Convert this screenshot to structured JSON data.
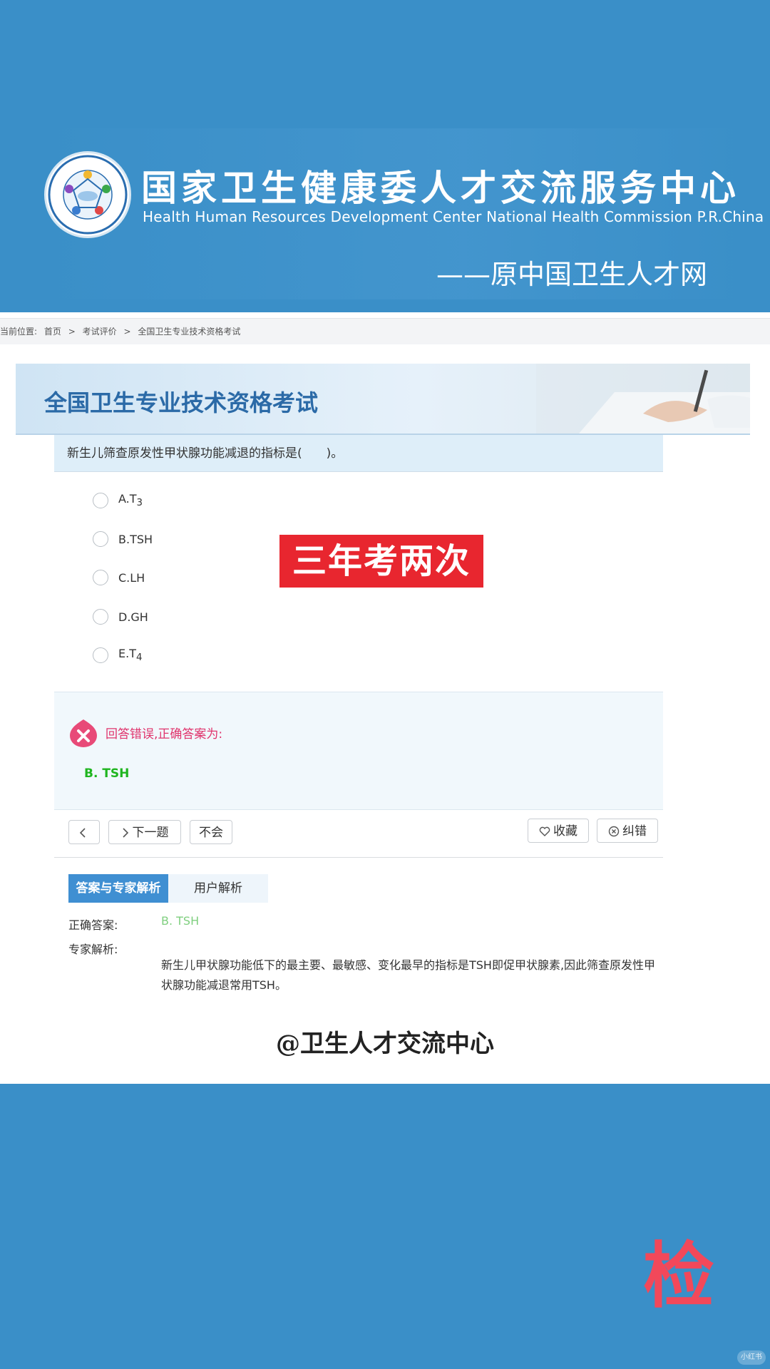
{
  "header": {
    "org_cn": "国家卫生健康委人才交流服务中心",
    "org_en": "Health Human Resources Development Center National Health Commission P.R.China",
    "former_name": "——原中国卫生人才网",
    "logo_text": "国家卫生健康委人才交流服务中心"
  },
  "breadcrumb": {
    "prefix": "当前位置:",
    "items": [
      "首页",
      "考试评价",
      "全国卫生专业技术资格考试"
    ],
    "separator": ">"
  },
  "exam_banner": {
    "title": "全国卫生专业技术资格考试"
  },
  "question": {
    "text": "新生儿筛查原发性甲状腺功能减退的指标是(　　)。",
    "options": [
      {
        "label": "A.T",
        "sub": "3"
      },
      {
        "label": "B.TSH",
        "sub": ""
      },
      {
        "label": "C.LH",
        "sub": ""
      },
      {
        "label": "D.GH",
        "sub": ""
      },
      {
        "label": "E.T",
        "sub": "4"
      }
    ]
  },
  "stamp": "三年考两次",
  "result": {
    "message": "回答错误,正确答案为:",
    "answer": "B. TSH"
  },
  "toolbar": {
    "prev_label": "",
    "next_label": "下一题",
    "dont_know_label": "不会",
    "favorite_label": "收藏",
    "report_label": "纠错"
  },
  "analysis_tabs": [
    "答案与专家解析",
    "用户解析"
  ],
  "analysis": {
    "correct_label": "正确答案:",
    "correct_value": "B. TSH",
    "expert_label": "专家解析:",
    "expert_text": "新生儿甲状腺功能低下的最主要、最敏感、变化最早的指标是TSH即促甲状腺素,因此筛查原发性甲状腺功能减退常用TSH。"
  },
  "signature": "@卫生人才交流中心",
  "corner_char": "检",
  "watermark": "小红书",
  "colors": {
    "background": "#3a8fc8",
    "stamp": "#e8262f",
    "error": "#e0336c",
    "correct": "#1fb51f",
    "tab_active": "#3f8fd2"
  }
}
